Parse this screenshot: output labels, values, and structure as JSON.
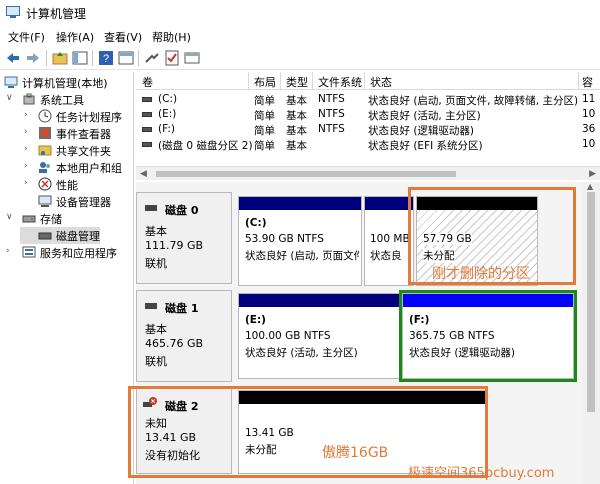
{
  "window": {
    "title": "计算机管理"
  },
  "menu": [
    "文件(F)",
    "操作(A)",
    "查看(V)",
    "帮助(H)"
  ],
  "tree": {
    "root": "计算机管理(本地)",
    "system_tools": "系统工具",
    "task_scheduler": "任务计划程序",
    "event_viewer": "事件查看器",
    "shared_folders": "共享文件夹",
    "local_users": "本地用户和组",
    "performance": "性能",
    "device_manager": "设备管理器",
    "storage": "存储",
    "disk_management": "磁盘管理",
    "services_apps": "服务和应用程序"
  },
  "columns": {
    "volume": "卷",
    "layout": "布局",
    "type": "类型",
    "fs": "文件系统",
    "status": "状态",
    "capacity": "容"
  },
  "volumes": [
    {
      "name": "(C:)",
      "layout": "简单",
      "type": "基本",
      "fs": "NTFS",
      "status": "状态良好 (启动, 页面文件, 故障转储, 主分区)",
      "cap": "11"
    },
    {
      "name": "(E:)",
      "layout": "简单",
      "type": "基本",
      "fs": "NTFS",
      "status": "状态良好 (活动, 主分区)",
      "cap": "10"
    },
    {
      "name": "(F:)",
      "layout": "简单",
      "type": "基本",
      "fs": "NTFS",
      "status": "状态良好 (逻辑驱动器)",
      "cap": "36"
    },
    {
      "name": "(磁盘 0 磁盘分区 2)",
      "layout": "简单",
      "type": "基本",
      "fs": "",
      "status": "状态良好 (EFI 系统分区)",
      "cap": "10"
    }
  ],
  "disks": {
    "d0": {
      "name": "磁盘 0",
      "kind": "基本",
      "size": "111.79 GB",
      "state": "联机",
      "p1": {
        "letter": "(C:)",
        "size": "53.90 GB NTFS",
        "status": "状态良好 (启动, 页面文件"
      },
      "p2": {
        "size": "100 MB",
        "status": "状态良"
      },
      "p3": {
        "size": "57.79 GB",
        "status": "未分配"
      }
    },
    "d1": {
      "name": "磁盘 1",
      "kind": "基本",
      "size": "465.76 GB",
      "state": "联机",
      "p1": {
        "letter": "(E:)",
        "size": "100.00 GB NTFS",
        "status": "状态良好 (活动, 主分区)"
      },
      "p2": {
        "letter": "(F:)",
        "size": "365.75 GB NTFS",
        "status": "状态良好 (逻辑驱动器)"
      }
    },
    "d2": {
      "name": "磁盘 2",
      "kind": "未知",
      "size": "13.41 GB",
      "state": "没有初始化",
      "p1": {
        "size": "13.41 GB",
        "status": "未分配"
      }
    }
  },
  "annotations": {
    "deleted": "刚才删除的分区",
    "aoteng": "傲腾16GB",
    "watermark": "极速空间365pcbuy.com"
  },
  "colors": {
    "primary": "#00007f",
    "logical": "#0000ff",
    "unallocated": "#000000",
    "annotation": "#e07b3a",
    "green": "#1a8a1a"
  }
}
